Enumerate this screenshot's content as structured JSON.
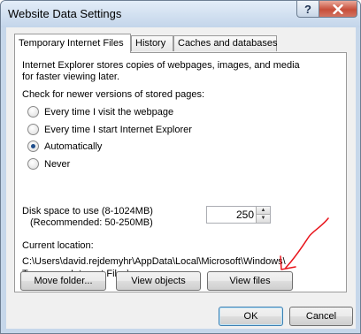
{
  "window": {
    "title": "Website Data Settings",
    "help_label": "?",
    "close_icon": "close-icon"
  },
  "tabs": [
    {
      "label": "Temporary Internet Files",
      "active": true
    },
    {
      "label": "History",
      "active": false
    },
    {
      "label": "Caches and databases",
      "active": false
    }
  ],
  "panel": {
    "description_line1": "Internet Explorer stores copies of webpages, images, and media",
    "description_line2": "for faster viewing later.",
    "check_label": "Check for newer versions of stored pages:",
    "options": [
      {
        "label": "Every time I visit the webpage",
        "checked": false
      },
      {
        "label": "Every time I start Internet Explorer",
        "checked": false
      },
      {
        "label": "Automatically",
        "checked": true
      },
      {
        "label": "Never",
        "checked": false
      }
    ],
    "disk_label_line1": "Disk space to use (8-1024MB)",
    "disk_label_line2": "(Recommended: 50-250MB)",
    "disk_value": "250",
    "location_label": "Current location:",
    "location_line1": "C:\\Users\\david.rejdemyhr\\AppData\\Local\\Microsoft\\Windows\\",
    "location_line2": "Temporary Internet Files\\",
    "buttons": {
      "move_folder": "Move folder...",
      "view_objects": "View objects",
      "view_files": "View files"
    }
  },
  "footer": {
    "ok": "OK",
    "cancel": "Cancel"
  },
  "annotation_color": "#e8141b"
}
